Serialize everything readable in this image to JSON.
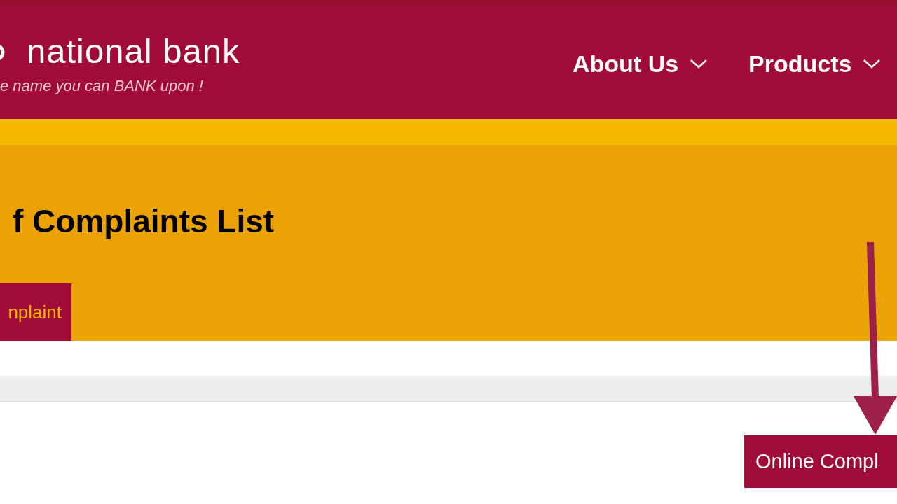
{
  "header": {
    "logo_text": "national bank",
    "tagline": "e name you can BANK upon !",
    "nav": [
      {
        "label": "About Us"
      },
      {
        "label": "Products"
      }
    ]
  },
  "banner": {
    "title": "f Complaints List",
    "button": "nplaint"
  },
  "callout": {
    "button": "Online Compl"
  }
}
